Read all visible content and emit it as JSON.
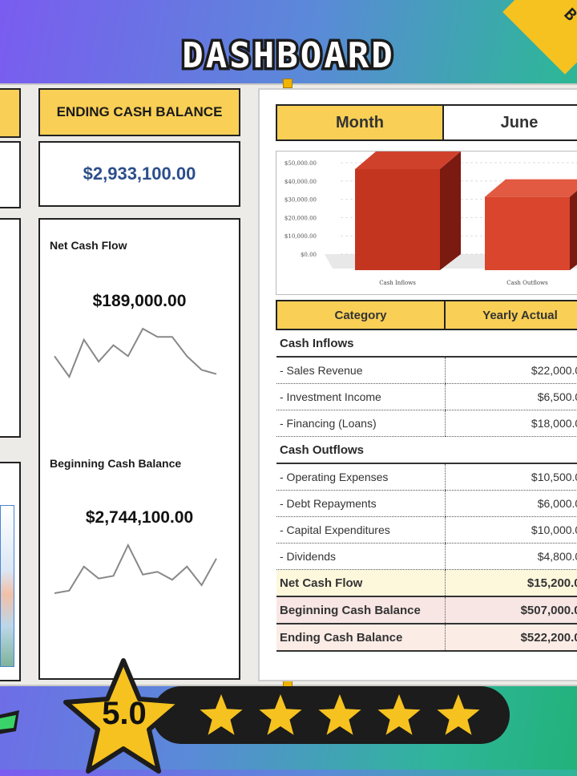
{
  "page": {
    "title": "DASHBOARD",
    "corner_glyph": "B"
  },
  "tiles": {
    "ending_label": "ENDING CASH BALANCE",
    "ending_value": "$2,933,100.00",
    "net_cash_flow": {
      "title": "Net Cash Flow",
      "value": "$189,000.00",
      "sparkline": [
        20,
        5,
        32,
        16,
        28,
        20,
        40,
        34,
        34,
        20,
        10,
        7
      ]
    },
    "beginning_balance": {
      "title": "Beginning Cash Balance",
      "value": "$2,744,100.00",
      "sparkline": [
        4,
        6,
        24,
        15,
        17,
        40,
        18,
        20,
        14,
        24,
        10,
        30
      ]
    }
  },
  "panel": {
    "month_label": "Month",
    "month_value": "June",
    "chart_data": {
      "type": "bar",
      "categories": [
        "Cash Inflows",
        "Cash Outflows"
      ],
      "values": [
        46500,
        31300
      ],
      "y_ticks": [
        "$50,000.00",
        "$40,000.00",
        "$30,000.00",
        "$20,000.00",
        "$10,000.00",
        "$0.00"
      ],
      "ylim": [
        0,
        50000
      ],
      "colors": [
        "#c43520",
        "#d9452d"
      ]
    },
    "table": {
      "headers": [
        "Category",
        "Yearly Actual"
      ],
      "rows": [
        {
          "label": "Cash Inflows",
          "amount": "",
          "kind": "section"
        },
        {
          "label": "- Sales Revenue",
          "amount": "$22,000.00",
          "kind": "item"
        },
        {
          "label": "- Investment Income",
          "amount": "$6,500.00",
          "kind": "item"
        },
        {
          "label": "- Financing (Loans)",
          "amount": "$18,000.00",
          "kind": "item"
        },
        {
          "label": "Cash Outflows",
          "amount": "",
          "kind": "section"
        },
        {
          "label": "- Operating Expenses",
          "amount": "$10,500.00",
          "kind": "item"
        },
        {
          "label": "- Debt Repayments",
          "amount": "$6,000.00",
          "kind": "item"
        },
        {
          "label": "- Capital Expenditures",
          "amount": "$10,000.00",
          "kind": "item"
        },
        {
          "label": "- Dividends",
          "amount": "$4,800.00",
          "kind": "item"
        },
        {
          "label": "Net Cash Flow",
          "amount": "$15,200.00",
          "kind": "total-ncf"
        },
        {
          "label": "Beginning Cash Balance",
          "amount": "$507,000.00",
          "kind": "total-bcb"
        },
        {
          "label": "Ending Cash Balance",
          "amount": "$522,200.00",
          "kind": "total-ecb"
        }
      ]
    }
  },
  "rating": {
    "score": "5.0",
    "stars": 5,
    "star_color": "#f6c21f"
  },
  "colors": {
    "accent_yellow": "#f9cf55",
    "value_blue": "#2c4f8a"
  }
}
